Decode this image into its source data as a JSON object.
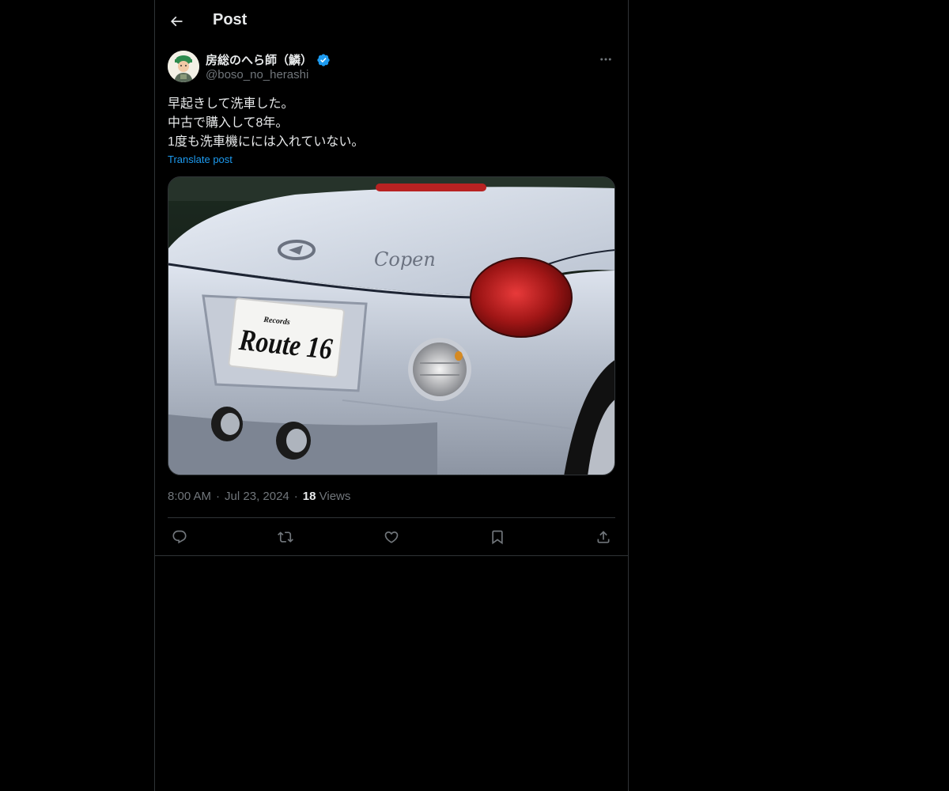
{
  "header": {
    "title": "Post",
    "back_icon": "arrow-left-icon"
  },
  "post": {
    "author": {
      "display_name": "房総のへら師（鱗）",
      "handle": "@boso_no_herashi",
      "verified": true,
      "verified_color": "#1d9bf0"
    },
    "text_lines": [
      "早起きして洗車した。",
      "中古で購入して8年。",
      "1度も洗車機にには入れていない。"
    ],
    "translate_label": "Translate post",
    "media": {
      "plate_small": "Records",
      "plate_text": "Route 16",
      "badge_script": "Copen"
    },
    "meta": {
      "time": "8:00 AM",
      "date": "Jul 23, 2024",
      "views_count": "18",
      "views_label": "Views",
      "separator": "·"
    },
    "actions": [
      "reply-icon",
      "repost-icon",
      "like-icon",
      "bookmark-icon",
      "share-icon"
    ]
  },
  "colors": {
    "background": "#000000",
    "text": "#e7e9ea",
    "secondary": "#71767b",
    "accent": "#1d9bf0",
    "border": "#2f3336"
  }
}
